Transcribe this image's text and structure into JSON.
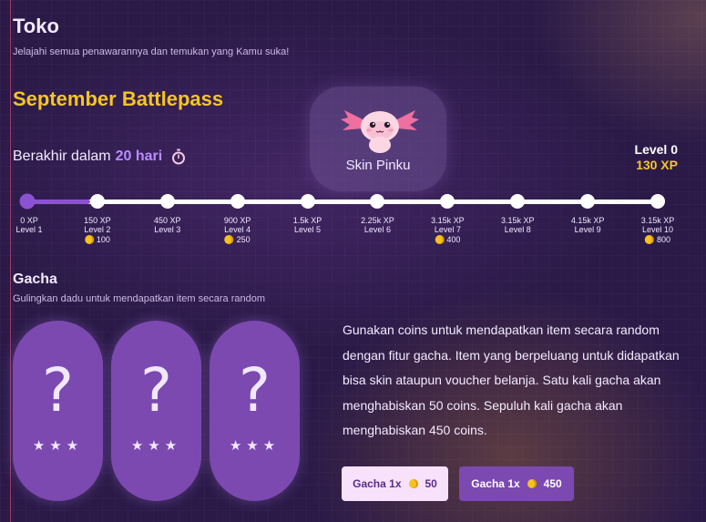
{
  "header": {
    "title": "Toko",
    "subtitle": "Jelajahi semua penawarannya dan temukan yang Kamu suka!"
  },
  "battlepass": {
    "title": "September Battlepass",
    "ends_prefix": "Berakhir dalam",
    "ends_value": "20 hari",
    "skin_name": "Skin Pinku",
    "current_level": "Level 0",
    "current_xp": "130 XP",
    "progress": 0.1,
    "levels": [
      {
        "xp": "0 XP",
        "level": "Level 1",
        "reward": ""
      },
      {
        "xp": "150 XP",
        "level": "Level 2",
        "reward": "100"
      },
      {
        "xp": "450 XP",
        "level": "Level 3",
        "reward": ""
      },
      {
        "xp": "900 XP",
        "level": "Level 4",
        "reward": "250"
      },
      {
        "xp": "1.5k XP",
        "level": "Level 5",
        "reward": ""
      },
      {
        "xp": "2.25k XP",
        "level": "Level 6",
        "reward": ""
      },
      {
        "xp": "3.15k XP",
        "level": "Level 7",
        "reward": "400"
      },
      {
        "xp": "3.15k XP",
        "level": "Level 8",
        "reward": ""
      },
      {
        "xp": "4.15k XP",
        "level": "Level 9",
        "reward": ""
      },
      {
        "xp": "3.15k XP",
        "level": "Level 10",
        "reward": "800"
      }
    ]
  },
  "gacha": {
    "title": "Gacha",
    "subtitle": "Gulingkan dadu untuk mendapatkan item secara random",
    "capsules": [
      {
        "symbol": "?",
        "stars": "★★★"
      },
      {
        "symbol": "?",
        "stars": "★★★"
      },
      {
        "symbol": "?",
        "stars": "★★★"
      }
    ],
    "description": "Gunakan coins untuk mendapatkan item secara random dengan fitur gacha. Item yang berpeluang untuk didapatkan bisa skin ataupun voucher belanja. Satu kali gacha akan menghabiskan 50 coins. Sepuluh kali gacha akan menghabiskan 450 coins.",
    "buttons": [
      {
        "label": "Gacha 1x",
        "cost": "50"
      },
      {
        "label": "Gacha 1x",
        "cost": "450"
      }
    ]
  },
  "colors": {
    "accent_gold": "#f5c526",
    "accent_purple": "#8c52d4",
    "coin": "#f6c21c"
  },
  "icons": {
    "timer": "stopwatch-icon",
    "coin": "coin-icon",
    "skin": "axolotl-icon"
  }
}
